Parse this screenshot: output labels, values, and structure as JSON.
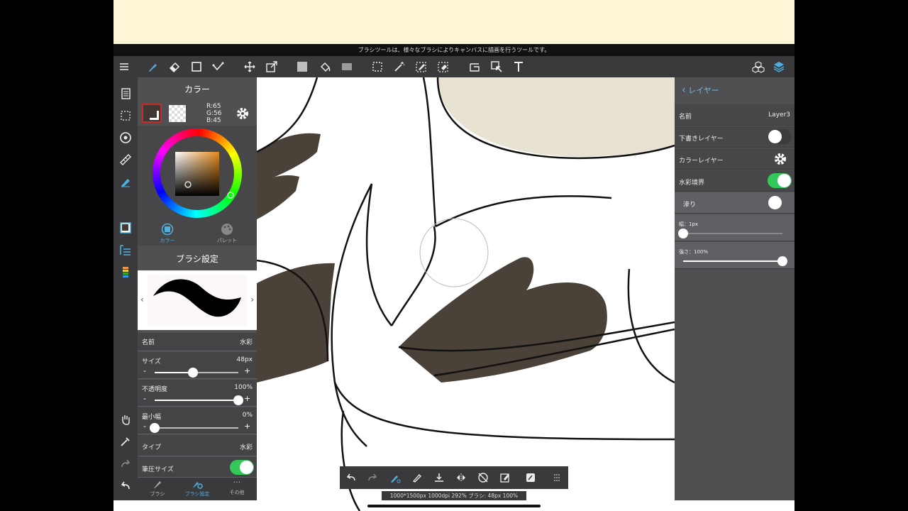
{
  "hint": "ブラシツールは、様々なブラシによりキャンバスに描画を行うツールです。",
  "colors": {
    "accent": "#4fb0e0",
    "toggle_on": "#34c759",
    "current_color": "#413833"
  },
  "toolbar": {
    "icons": [
      "menu-icon",
      "brush-icon",
      "eraser-icon",
      "rectangle-icon",
      "curve-icon",
      "move-icon",
      "transform-icon",
      "fill-color-icon",
      "bucket-icon",
      "gradient-icon",
      "select-icon",
      "magic-wand-icon",
      "select-pen-icon",
      "select-eraser-icon",
      "crop-icon",
      "lasso-move-icon",
      "text-icon",
      "material-icon",
      "layers-icon"
    ]
  },
  "color_panel": {
    "title": "カラー",
    "r": "R:65",
    "g": "G:56",
    "b": "B:45",
    "tab_color": "カラー",
    "tab_palette": "パレット"
  },
  "brush_settings": {
    "title": "ブラシ設定",
    "name_label": "名前",
    "name_value": "水彩",
    "size_label": "サイズ",
    "size_value": "48px",
    "size_level": 0.46,
    "opacity_label": "不透明度",
    "opacity_value": "100%",
    "opacity_level": 1.0,
    "min_width_label": "最小幅",
    "min_width_value": "0%",
    "min_width_level": 0.0,
    "type_label": "タイプ",
    "type_value": "水彩",
    "pressure_label": "筆圧サイズ",
    "pressure_on": true
  },
  "bottom_tabs": {
    "brush": "ブラシ",
    "brush_settings": "ブラシ設定",
    "other": "その他"
  },
  "layer_panel": {
    "back_label": "レイヤー",
    "name_label": "名前",
    "name_value": "Layer3",
    "draft_label": "下書きレイヤー",
    "draft_on": false,
    "color_layer_label": "カラーレイヤー",
    "watercolor_edge_label": "水彩境界",
    "watercolor_edge_on": true,
    "blur_label": "滲り",
    "blur_on": false,
    "width_label": "幅：1px",
    "width_level": 0.0,
    "strength_label": "強さ：100%",
    "strength_level": 1.0
  },
  "status": "1000*1500px 1000dpi 292% ブラシ: 48px 100%"
}
